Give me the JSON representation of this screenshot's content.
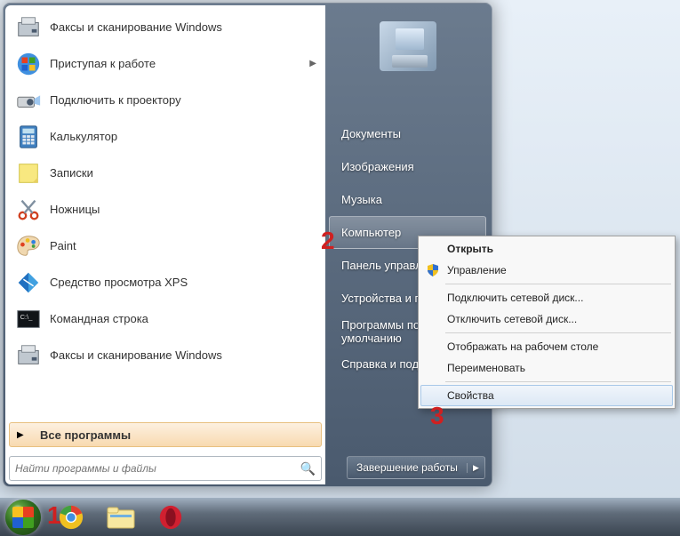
{
  "programs": [
    {
      "label": "Факсы и сканирование Windows",
      "icon": "fax-scan-icon",
      "has_arrow": false
    },
    {
      "label": "Приступая к работе",
      "icon": "getting-started-icon",
      "has_arrow": true
    },
    {
      "label": "Подключить к проектору",
      "icon": "projector-icon",
      "has_arrow": false
    },
    {
      "label": "Калькулятор",
      "icon": "calculator-icon",
      "has_arrow": false
    },
    {
      "label": "Записки",
      "icon": "sticky-notes-icon",
      "has_arrow": false
    },
    {
      "label": "Ножницы",
      "icon": "snipping-tool-icon",
      "has_arrow": false
    },
    {
      "label": "Paint",
      "icon": "paint-icon",
      "has_arrow": false
    },
    {
      "label": "Средство просмотра XPS",
      "icon": "xps-viewer-icon",
      "has_arrow": false
    },
    {
      "label": "Командная строка",
      "icon": "cmd-icon",
      "has_arrow": false
    },
    {
      "label": "Факсы и сканирование Windows",
      "icon": "fax-scan-icon",
      "has_arrow": false
    }
  ],
  "all_programs_label": "Все программы",
  "search": {
    "placeholder": "Найти программы и файлы"
  },
  "right_links": [
    {
      "label": "Документы",
      "hovered": false
    },
    {
      "label": "Изображения",
      "hovered": false
    },
    {
      "label": "Музыка",
      "hovered": false
    },
    {
      "label": "Компьютер",
      "hovered": true
    },
    {
      "label": "Панель управления",
      "hovered": false
    },
    {
      "label": "Устройства и принтеры",
      "hovered": false
    },
    {
      "label": "Программы по умолчанию",
      "hovered": false
    },
    {
      "label": "Справка и поддержка",
      "hovered": false
    }
  ],
  "shutdown_label": "Завершение работы",
  "context_menu": [
    {
      "label": "Открыть",
      "bold": true,
      "sep_after": false
    },
    {
      "label": "Управление",
      "shield": true,
      "sep_after": true
    },
    {
      "label": "Подключить сетевой диск...",
      "sep_after": false
    },
    {
      "label": "Отключить сетевой диск...",
      "sep_after": true
    },
    {
      "label": "Отображать на рабочем столе",
      "sep_after": false
    },
    {
      "label": "Переименовать",
      "sep_after": true
    },
    {
      "label": "Свойства",
      "hovered": true,
      "sep_after": false
    }
  ],
  "callouts": {
    "c1": "1",
    "c2": "2",
    "c3": "3"
  }
}
